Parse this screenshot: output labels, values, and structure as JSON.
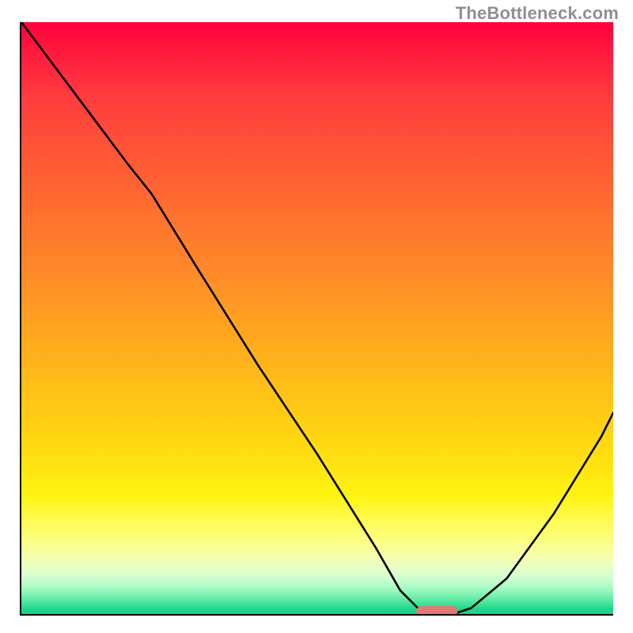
{
  "watermark": "TheBottleneck.com",
  "chart_data": {
    "type": "line",
    "title": "",
    "xlabel": "",
    "ylabel": "",
    "xlim": [
      0,
      100
    ],
    "ylim": [
      0,
      100
    ],
    "grid": false,
    "legend": false,
    "description": "Black curve over a vertical red-to-green gradient background. Curve descends from top-left, reaches a minimum around x≈70, then rises toward the right edge.",
    "x": [
      0,
      6,
      12,
      18,
      22,
      30,
      40,
      50,
      60,
      64,
      67,
      70,
      73,
      76,
      82,
      90,
      98,
      100
    ],
    "y": [
      100,
      92,
      84,
      76,
      71,
      58,
      42,
      27,
      11,
      4,
      1,
      0,
      0,
      1,
      6,
      17,
      30,
      34
    ],
    "marker": {
      "x_center": 70,
      "y": 0,
      "color": "#e27a74",
      "shape": "pill"
    },
    "gradient_stops": [
      {
        "pos": 0,
        "color": "#ff003b"
      },
      {
        "pos": 0.5,
        "color": "#ffc017"
      },
      {
        "pos": 0.82,
        "color": "#fffb4f"
      },
      {
        "pos": 1,
        "color": "#15d486"
      }
    ]
  }
}
